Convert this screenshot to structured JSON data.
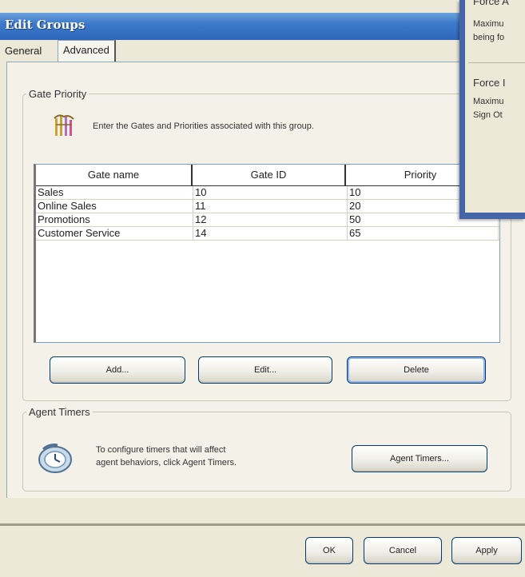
{
  "window": {
    "title": "Edit Groups"
  },
  "tabs": [
    {
      "label": "General"
    },
    {
      "label": "Advanced"
    }
  ],
  "gate_priority": {
    "legend": "Gate Priority",
    "description": "Enter the Gates and Priorities associated with this group.",
    "icon": "gates-icon",
    "columns": [
      "Gate name",
      "Gate ID",
      "Priority"
    ],
    "rows": [
      [
        "Sales",
        "10",
        "10"
      ],
      [
        "Online Sales",
        "11",
        "20"
      ],
      [
        "Promotions",
        "12",
        "50"
      ],
      [
        "Customer Service",
        "14",
        "65"
      ]
    ],
    "buttons": {
      "add": "Add...",
      "edit": "Edit...",
      "delete": "Delete"
    }
  },
  "agent_timers": {
    "legend": "Agent Timers",
    "description_line1": "To configure timers that will affect",
    "description_line2": "agent behaviors, click Agent Timers.",
    "icon": "clock-icon",
    "button": "Agent Timers..."
  },
  "footer": {
    "ok": "OK",
    "cancel": "Cancel",
    "apply": "Apply"
  },
  "overlay": {
    "group1_label": "Force A",
    "group1_desc1": "Maximu",
    "group1_desc2": "being fo",
    "group2_label": "Force I",
    "group2_desc1": "Maximu",
    "group2_desc2": "Sign Ot"
  },
  "colors": {
    "title_bar": "#2d67bb",
    "dialog_bg": "#ece9d8",
    "button_border": "#003c74"
  }
}
